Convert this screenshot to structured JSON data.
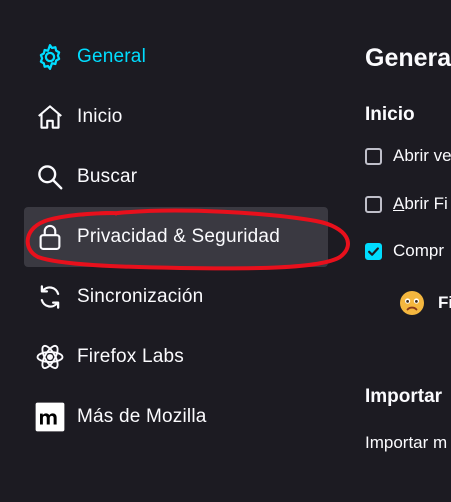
{
  "sidebar": {
    "items": [
      {
        "label": "General",
        "icon": "gear-icon"
      },
      {
        "label": "Inicio",
        "icon": "home-icon"
      },
      {
        "label": "Buscar",
        "icon": "search-icon"
      },
      {
        "label": "Privacidad & Seguridad",
        "icon": "lock-icon"
      },
      {
        "label": "Sincronización",
        "icon": "sync-icon"
      },
      {
        "label": "Firefox Labs",
        "icon": "atom-icon"
      },
      {
        "label": "Más de Mozilla",
        "icon": "mozilla-m-icon"
      }
    ],
    "active_index": 0,
    "selected_index": 3
  },
  "main": {
    "title": "Genera",
    "startup": {
      "heading": "Inicio",
      "options": [
        {
          "label": "Abrir ve",
          "checked": false
        },
        {
          "label": "Abrir Fi",
          "checked": false
        },
        {
          "label": "Compr",
          "checked": true
        }
      ],
      "status_text": "Fi"
    },
    "import": {
      "heading": "Importar",
      "text": "Importar m"
    }
  },
  "colors": {
    "background": "#1c1b22",
    "accent": "#00ddff",
    "selected_bg": "#3a3941",
    "annotation": "#e8101c"
  }
}
